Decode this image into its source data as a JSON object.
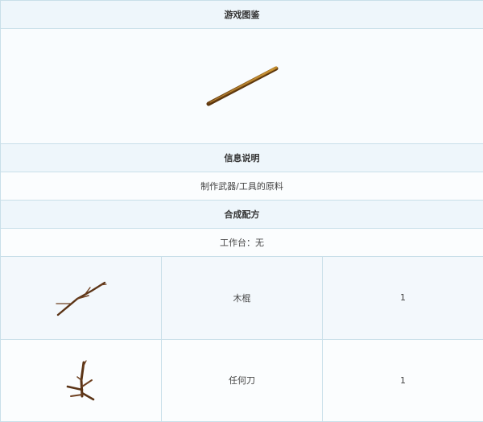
{
  "sections": {
    "gallery_title": "游戏图鉴",
    "info_title": "信息说明",
    "info_text": "制作武器/工具的原料",
    "recipe_title": "合成配方",
    "workbench": "工作台：无"
  },
  "item": {
    "icon": "wooden-stick-icon"
  },
  "ingredients": [
    {
      "icon": "branch-icon",
      "name": "木棍",
      "qty": "1"
    },
    {
      "icon": "twig-icon",
      "name": "任何刀",
      "qty": "1"
    }
  ]
}
